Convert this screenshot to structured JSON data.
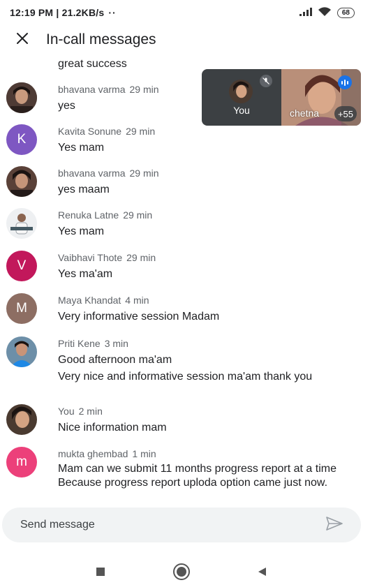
{
  "status_bar": {
    "time_speed": "12:19 PM | 21.2KB/s",
    "dots": "··",
    "battery": "68",
    "icons": [
      "signal-icon",
      "wifi-icon",
      "battery-icon"
    ]
  },
  "header": {
    "title": "In-call messages",
    "close_icon": "close-icon"
  },
  "messages": [
    {
      "sender": "",
      "time": "",
      "text": "great success",
      "avatar_type": "none"
    },
    {
      "sender": "bhavana varma",
      "time": "29 min",
      "text": "yes",
      "avatar_type": "photo"
    },
    {
      "sender": "Kavita Sonune",
      "time": "29 min",
      "text": "Yes mam",
      "avatar_type": "letter",
      "avatar_letter": "K",
      "avatar_color": "#7e57c2"
    },
    {
      "sender": "bhavana varma",
      "time": "29 min",
      "text": "yes maam",
      "avatar_type": "photo"
    },
    {
      "sender": "Renuka Latne",
      "time": "29 min",
      "text": "Yes mam",
      "avatar_type": "photo"
    },
    {
      "sender": "Vaibhavi Thote",
      "time": "29 min",
      "text": "Yes ma'am",
      "avatar_type": "letter",
      "avatar_letter": "V",
      "avatar_color": "#c2185b"
    },
    {
      "sender": "Maya Khandat",
      "time": "4 min",
      "text": "Very informative session Madam",
      "avatar_type": "letter",
      "avatar_letter": "M",
      "avatar_color": "#8d6e63"
    },
    {
      "sender": "Priti Kene",
      "time": "3 min",
      "text": "Good afternoon ma'am",
      "text2": "Very nice and informative session ma'am thank you",
      "avatar_type": "photo"
    },
    {
      "sender": "You",
      "time": "2 min",
      "text": "Nice information mam",
      "avatar_type": "photo"
    },
    {
      "sender": "mukta ghembad",
      "time": "1 min",
      "text": "Mam can we submit 11 months  progress report at a time Because  progress report uploda option came just now.",
      "avatar_type": "letter",
      "avatar_letter": "m",
      "avatar_color": "#ec407a"
    }
  ],
  "pip": {
    "self_label": "You",
    "other_name": "chetna",
    "participant_count": "+55",
    "self_mic_icon": "mic-off-icon",
    "speaking_icon": "speaking-indicator-icon"
  },
  "composer": {
    "placeholder": "Send message",
    "value": "",
    "send_icon": "send-icon"
  },
  "navbar": {
    "icons": [
      "recents-icon",
      "home-icon",
      "back-icon"
    ]
  },
  "colors": {
    "primary_text": "#202124",
    "secondary_text": "#5f6368",
    "composer_bg": "#f1f3f4",
    "pip_bg": "#3c4043"
  }
}
